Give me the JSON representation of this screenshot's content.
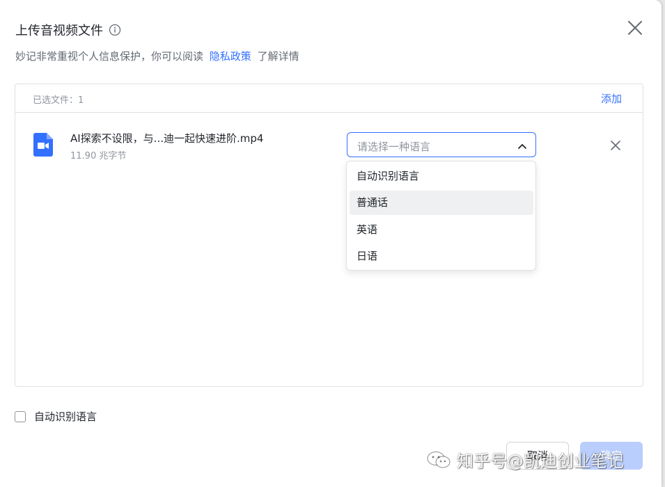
{
  "dialog": {
    "title": "上传音视频文件",
    "subtitle_before": "妙记非常重视个人信息保护，你可以阅读",
    "subtitle_link": "隐私政策",
    "subtitle_after": "了解详情"
  },
  "files": {
    "selected_label": "已选文件：1",
    "add_label": "添加",
    "items": [
      {
        "name": "AI探索不设限，与...迪一起快速进阶.mp4",
        "size": "11.90 兆字节",
        "language_placeholder": "请选择一种语言"
      }
    ]
  },
  "language_dropdown": {
    "options": [
      "自动识别语言",
      "普通话",
      "英语",
      "日语"
    ],
    "hovered_index": 1
  },
  "footer": {
    "auto_detect_label": "自动识别语言",
    "auto_detect_checked": false,
    "cancel_label": "取消",
    "confirm_label": "确定"
  },
  "watermark": {
    "text": "知乎号@凯迪创业笔记"
  },
  "colors": {
    "accent": "#3370ff",
    "text_primary": "#1f2329",
    "text_secondary": "#646a73",
    "muted": "#8f959e",
    "border": "#dee0e3",
    "file_icon": "#3370ff",
    "confirm_disabled": "#bacefd"
  }
}
